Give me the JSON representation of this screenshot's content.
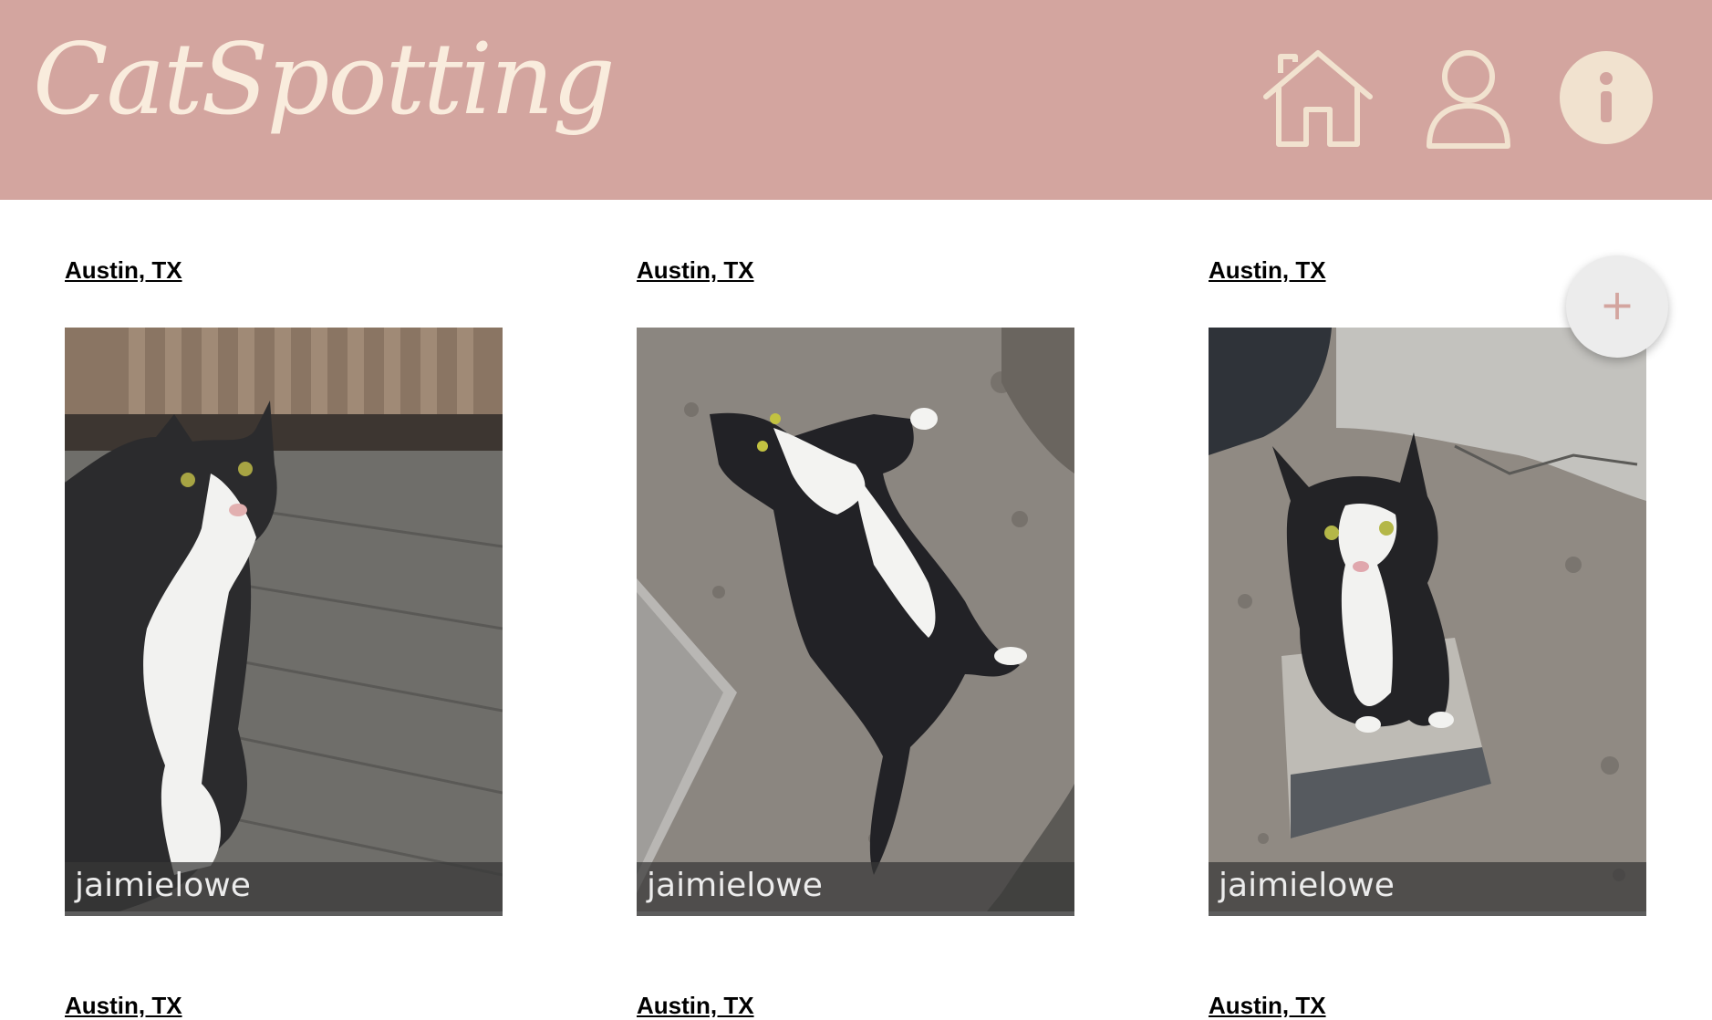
{
  "app": {
    "title": "CatSpotting",
    "brand_color": "#d3a59f",
    "logo_color": "#f9ecdd"
  },
  "nav": {
    "home_icon": "home-icon",
    "profile_icon": "user-icon",
    "info_icon": "info-icon",
    "info_glyph": "i"
  },
  "posts": [
    {
      "location": "Austin, TX",
      "user": "jaimielowe",
      "photo": "black and white cat sitting on wooden deck"
    },
    {
      "location": "Austin, TX",
      "user": "jaimielowe",
      "photo": "black and white cat lying on dirt ground"
    },
    {
      "location": "Austin, TX",
      "user": "jaimielowe",
      "photo": "black and white cat sitting on concrete paver"
    },
    {
      "location": "Austin, TX"
    },
    {
      "location": "Austin, TX"
    },
    {
      "location": "Austin, TX"
    }
  ],
  "fab": {
    "label": "+",
    "icon": "plus-icon"
  }
}
